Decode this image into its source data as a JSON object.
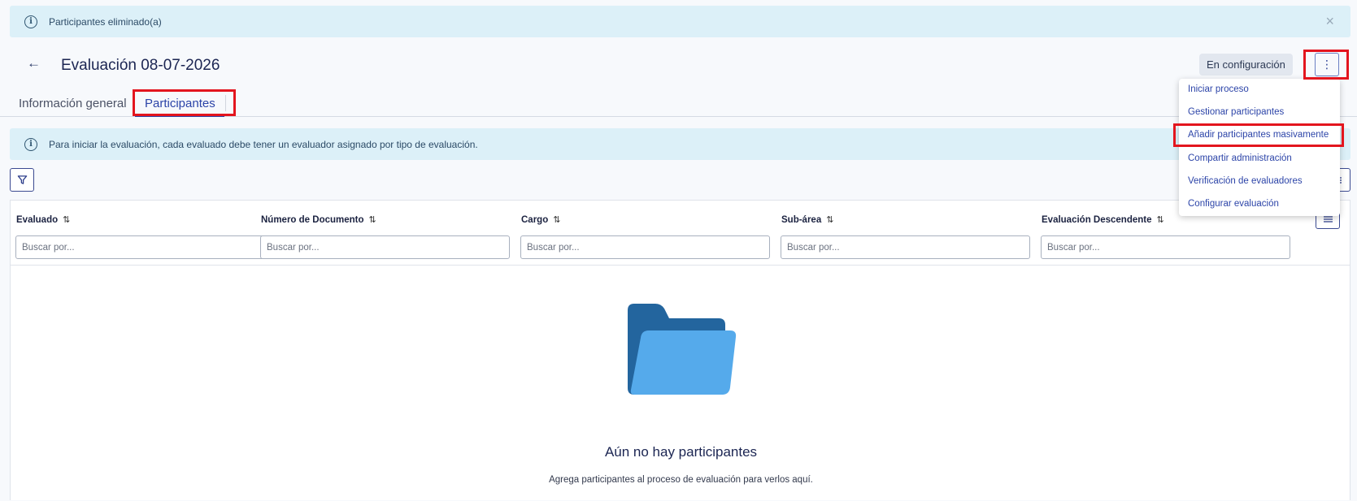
{
  "toast": {
    "message": "Participantes eliminado(a)",
    "close": "×"
  },
  "header": {
    "back": "←",
    "title": "Evaluación 08-07-2026",
    "status": "En configuración",
    "menu_button": "⋮"
  },
  "tabs": [
    {
      "label": "Información general"
    },
    {
      "label": "Participantes"
    }
  ],
  "banner": {
    "message": "Para iniciar la evaluación, cada evaluado debe tener un evaluador asignado por tipo de evaluación."
  },
  "table": {
    "columns": [
      {
        "title": "Evaluado",
        "placeholder": "Buscar por..."
      },
      {
        "title": "Número de Documento",
        "placeholder": "Buscar por..."
      },
      {
        "title": "Cargo",
        "placeholder": "Buscar por..."
      },
      {
        "title": "Sub-área",
        "placeholder": "Buscar por..."
      },
      {
        "title": "Evaluación Descendente",
        "placeholder": "Buscar por..."
      }
    ],
    "sort_icon": "⇅"
  },
  "empty_state": {
    "title": "Aún no hay participantes",
    "subtitle": "Agrega participantes al proceso de evaluación para verlos aquí."
  },
  "menu": {
    "items": [
      {
        "label": "Iniciar proceso"
      },
      {
        "label": "Gestionar participantes"
      },
      {
        "label": "Añadir participantes masivamente"
      },
      {
        "label": "Compartir administración"
      },
      {
        "label": "Verificación de evaluadores"
      },
      {
        "label": "Configurar evaluación"
      }
    ]
  },
  "colors": {
    "accent": "#2c44a8",
    "info_bg": "#dcf0f8",
    "highlight": "#e3151e",
    "folder_dark": "#23659e",
    "folder_light": "#55aaeb"
  },
  "icons": {
    "info": "info-icon",
    "close": "close-icon",
    "back": "arrow-left-icon",
    "kebab": "more-vertical-icon",
    "filter": "filter-icon",
    "columns": "columns-settings-icon",
    "folder": "folder-icon"
  }
}
